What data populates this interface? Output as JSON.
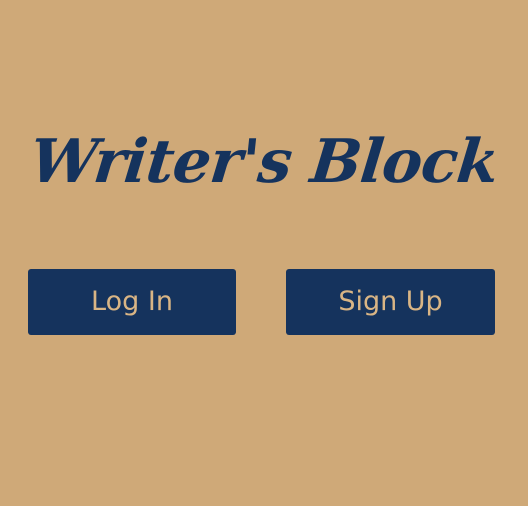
{
  "app": {
    "title": "Writer's Block"
  },
  "buttons": {
    "login_label": "Log In",
    "signup_label": "Sign Up"
  },
  "colors": {
    "background": "#CFA978",
    "primary": "#15335D",
    "button_text": "#D9B585"
  }
}
